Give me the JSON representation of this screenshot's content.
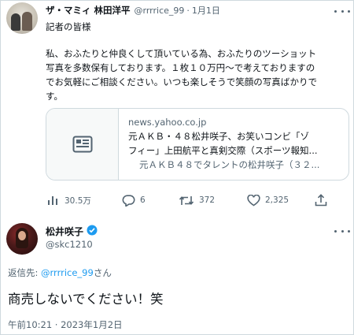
{
  "tweet1": {
    "name": "ザ・マミィ 林田洋平",
    "handle": "@rrrrice_99",
    "separator": "·",
    "time": "1月1日",
    "lines": [
      "記者の皆様",
      "",
      "私、おふたりと仲良くして頂いている為、おふたりのツーショット",
      "写真を多数保有しております。１枚１０万円〜で考えておりますの",
      "でお気軽にご相談ください。いつも楽しそうで笑顔の写真ばかりで",
      "す。"
    ],
    "card": {
      "domain": "news.yahoo.co.jp",
      "title_line1": "元ＡＫＢ・４８松井咲子、お笑いコンビ「ゾ",
      "title_line2": "フィー」上田航平と真剣交際（スポーツ報知...",
      "description": "元ＡＫＢ４８でタレントの松井咲子（３２..."
    },
    "actions": {
      "views": "30.5万",
      "replies": "6",
      "retweets": "372",
      "likes": "2,325"
    }
  },
  "tweet2": {
    "name": "松井咲子",
    "verified_color": "#1d9bf0",
    "handle": "@skc1210",
    "reply_prefix": "返信先: ",
    "reply_mention": "@rrrrice_99",
    "reply_suffix": "さん",
    "text": "商売しないでください！笑",
    "timestamp": "午前10:21 · 2023年1月2日"
  },
  "icons": [
    "more-icon",
    "article-icon",
    "views-icon",
    "reply-icon",
    "retweet-icon",
    "like-icon",
    "share-icon",
    "verified-icon"
  ],
  "colors": {
    "text": "#0f1419",
    "muted": "#536471",
    "link": "#1d9bf0",
    "border": "#cfd9de"
  }
}
